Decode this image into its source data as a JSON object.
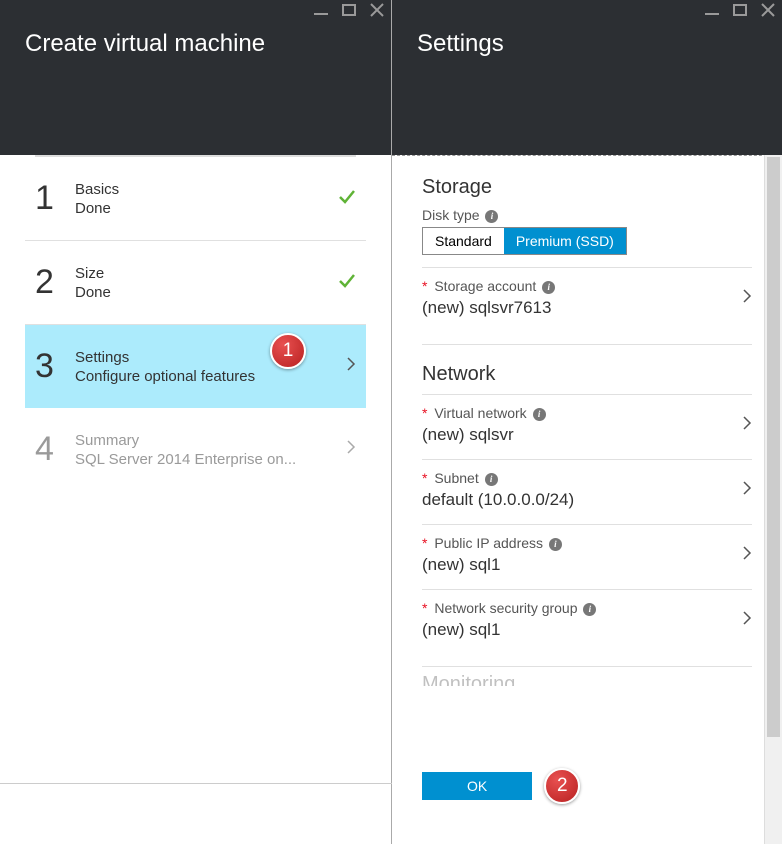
{
  "left_panel": {
    "title": "Create virtual machine",
    "steps": [
      {
        "number": "1",
        "title": "Basics",
        "subtitle": "Done",
        "state": "done"
      },
      {
        "number": "2",
        "title": "Size",
        "subtitle": "Done",
        "state": "done"
      },
      {
        "number": "3",
        "title": "Settings",
        "subtitle": "Configure optional features",
        "state": "active"
      },
      {
        "number": "4",
        "title": "Summary",
        "subtitle": "SQL Server 2014 Enterprise on...",
        "state": "disabled"
      }
    ]
  },
  "right_panel": {
    "title": "Settings",
    "sections": {
      "storage": {
        "header": "Storage",
        "disk_type_label": "Disk type",
        "disk_type_options": {
          "standard": "Standard",
          "premium": "Premium (SSD)"
        },
        "disk_type_selected": "premium",
        "storage_account_label": "Storage account",
        "storage_account_value": "(new) sqlsvr7613"
      },
      "network": {
        "header": "Network",
        "virtual_network_label": "Virtual network",
        "virtual_network_value": "(new) sqlsvr",
        "subnet_label": "Subnet",
        "subnet_value": "default (10.0.0.0/24)",
        "public_ip_label": "Public IP address",
        "public_ip_value": "(new) sql1",
        "nsg_label": "Network security group",
        "nsg_value": "(new) sql1"
      },
      "monitoring": {
        "header": "Monitoring"
      }
    },
    "ok_label": "OK"
  },
  "callouts": {
    "one": "1",
    "two": "2"
  }
}
